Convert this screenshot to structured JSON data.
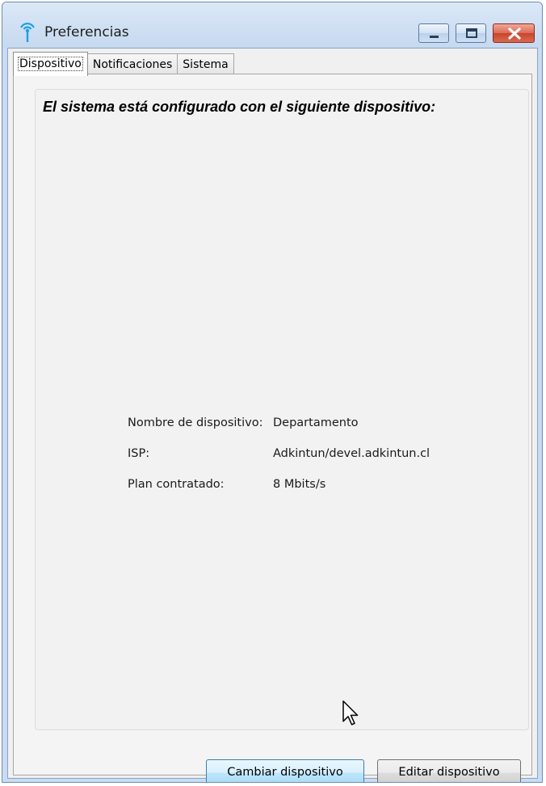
{
  "window": {
    "title": "Preferencias",
    "icon": "antenna-icon",
    "controls": [
      "minimize-icon",
      "maximize-icon",
      "close-icon"
    ]
  },
  "tabs": [
    {
      "label": "Dispositivo",
      "active": true
    },
    {
      "label": "Notificaciones",
      "active": false
    },
    {
      "label": "Sistema",
      "active": false
    }
  ],
  "device_panel": {
    "heading": "El sistema está configurado con el siguiente dispositivo:",
    "rows": [
      {
        "label": "Nombre de dispositivo:",
        "value": "Departamento"
      },
      {
        "label": "ISP:",
        "value": "Adkintun/devel.adkintun.cl"
      },
      {
        "label": "Plan contratado:",
        "value": "8 Mbits/s"
      }
    ]
  },
  "buttons": {
    "change_label": "Cambiar dispositivo",
    "edit_label": "Editar dispositivo"
  },
  "colors": {
    "titlebar": "#c6d9ef",
    "accent_icon": "#1ba1e2",
    "close_button": "#c7452e",
    "hover_button": "#bee6fd"
  }
}
